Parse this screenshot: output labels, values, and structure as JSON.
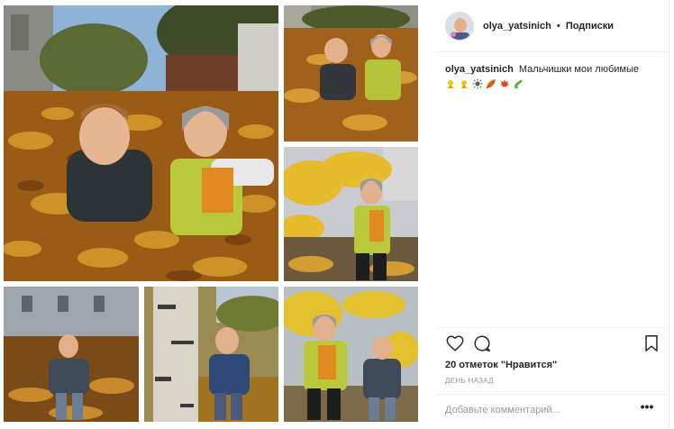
{
  "post": {
    "author": {
      "username": "olya_yatsinich",
      "separator": "•",
      "follow_label": "Подписки"
    },
    "caption": {
      "username": "olya_yatsinich",
      "text": "Мальчишки мои любимые"
    },
    "emojis": [
      "chick-emoji",
      "chick-emoji",
      "sun-emoji",
      "leaf-emoji",
      "maple-leaf-emoji",
      "herb-emoji"
    ],
    "likes_text": "20 отметок \"Нравится\"",
    "time_text": "ДЕНЬ НАЗАД",
    "comment": {
      "placeholder": "Добавьте комментарий...",
      "value": ""
    },
    "more_label": "•••"
  },
  "icons": [
    "heart-icon",
    "comment-icon",
    "bookmark-icon",
    "more-options-icon"
  ],
  "colors": {
    "text": "#262626",
    "muted": "#999999",
    "separator": "#efefef",
    "leaves": "#b8741a"
  }
}
